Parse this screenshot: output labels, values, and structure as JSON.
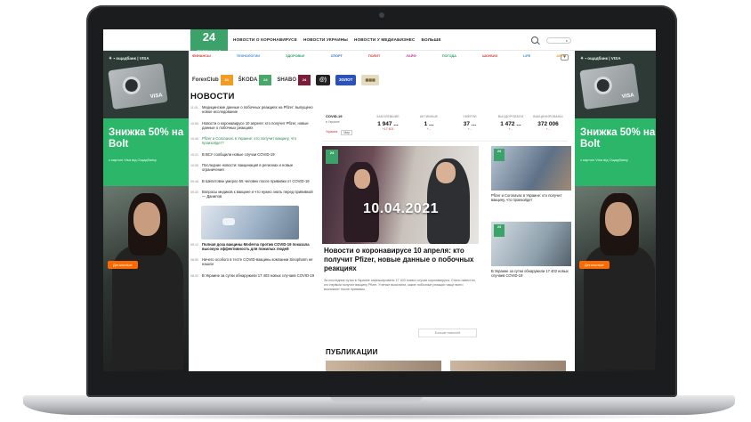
{
  "site": {
    "logo_number": "24",
    "logo_sub": "ТЕЛЕКАНАЛ"
  },
  "nav": {
    "items": [
      "НОВОСТИ О КОРОНАВИРУСЕ",
      "НОВОСТИ УКРАИНЫ",
      "НОВОСТИ У МЕДИАБИЗНЕС",
      "БОЛЬШЕ"
    ]
  },
  "categories": {
    "items": [
      {
        "label": "ФИНАНСЫ",
        "color": "#d4372c"
      },
      {
        "label": "ТЕХНОЛОГИИ",
        "color": "#3a8ed6"
      },
      {
        "label": "ЗДОРОВЬЕ",
        "color": "#27a36a"
      },
      {
        "label": "СПОРТ",
        "color": "#2f6fd0"
      },
      {
        "label": "ПОЛИТ",
        "color": "#d4372c"
      },
      {
        "label": "ЛАЙФ",
        "color": "#c23a9a"
      },
      {
        "label": "ПОГОДА",
        "color": "#27a36a"
      },
      {
        "label": "ШОУБИЗ",
        "color": "#d4372c"
      },
      {
        "label": "LIFE",
        "color": "#3a8ed6"
      },
      {
        "label": "АВТО",
        "color": "#f29c23"
      }
    ],
    "more": "▾"
  },
  "partners": {
    "items": [
      "ForexClub",
      "ŠKODA",
      "SHABO",
      "@)",
      "ЗОЛОТ"
    ],
    "badge": "24"
  },
  "ads": {
    "brand": "⚘ ▪ ощадбанк | VISA",
    "headline": "Знижка 50% на Bolt",
    "note": "з картою Visa від Ощадбанку",
    "cta": "Детальніше",
    "card_visa": "VISA"
  },
  "news": {
    "title": "НОВОСТИ",
    "items": [
      {
        "time": "11:01",
        "text": "Медицинские данные о побочных реакциях на Pfizer: выпущено новое исследование",
        "style": "normal"
      },
      {
        "time": "10:55",
        "text": "Новости о коронавирусе 10 апреля: кто получит Pfizer, новые данные о побочных реакциях",
        "style": "normal"
      },
      {
        "time": "10:40",
        "text": "Pfizer и Coronavac в Украине: кто получит вакцину, что произойдет?",
        "style": "green"
      },
      {
        "time": "10:21",
        "text": "В ВСУ сообщили новые случаи COVID-19",
        "style": "normal"
      },
      {
        "time": "10:05",
        "text": "Последние новости: вакцинация в регионах и новые ограничения",
        "style": "normal"
      },
      {
        "time": "09:48",
        "text": "В Шепетовке умерло 55 человек после прививки от COVID-19",
        "style": "normal"
      },
      {
        "time": "09:30",
        "text": "Вопросы медиков к вакцине и что нужно знать перед прививкой — Данилов",
        "style": "normal"
      }
    ],
    "featured": {
      "time": "09:12",
      "text": "Полная доза вакцины Moderna против COVID-19 показала высокую эффективность для пожилых людей"
    },
    "items2": [
      {
        "time": "08:50",
        "text": "Ничего особого в тесте COVID-вакцины компании Sinopharm не нашли",
        "style": "normal"
      },
      {
        "time": "08:32",
        "text": "В Украине за сутки обнаружили 17 403 новых случаев COVID-19",
        "style": "normal"
      }
    ]
  },
  "covid": {
    "label": "COVID-19",
    "sub": "в Украине",
    "flag_ukraine": "Украина",
    "flag_world": "Мир",
    "stats": [
      {
        "label": "ЗАБОЛЕВШИЕ",
        "value": "1 947 ...",
        "delta": "+17 403"
      },
      {
        "label": "АКТИВНЫЕ",
        "value": "1 ...",
        "delta": "+..."
      },
      {
        "label": "УМЕРЛИ",
        "value": "37 ...",
        "delta": "+..."
      },
      {
        "label": "ВЫЗДОРОВЕЛИ",
        "value": "1 472 ...",
        "delta": "+..."
      },
      {
        "label": "ВАКЦИНИРОВАНЫ",
        "value": "372 006",
        "delta": "+..."
      }
    ]
  },
  "hero": {
    "badge": "24",
    "date": "10.04.2021",
    "title": "Новости о коронавирусе 10 апреля: кто получит Pfizer, новые данные о побочных реакциях",
    "lead": "За последние сутки в Украине зафиксировали 17 403 новых случая коронавируса. Стало известно, кто первым получит вакцину Pfizer. Ученые выяснили, какие побочные реакции чаще всего возникают после прививки."
  },
  "more_button": "Больше новостей",
  "publications": {
    "title": "ПУБЛИКАЦИИ"
  },
  "side": {
    "cards": [
      {
        "badge": "24",
        "text": "Pfizer и Coronavac в Украине: кто получит вакцину, что произойдет"
      },
      {
        "badge": "24",
        "text": "В Украине за сутки обнаружили 17 403 новых случаев COVID-19"
      }
    ]
  }
}
